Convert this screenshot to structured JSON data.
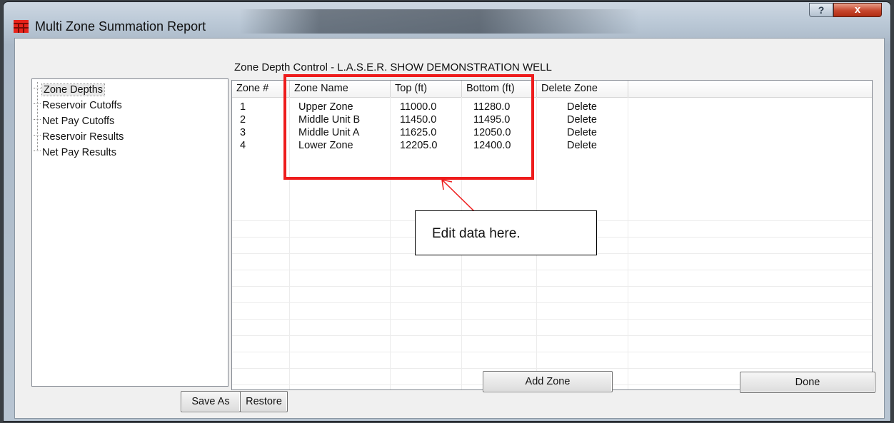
{
  "window": {
    "title": "Multi Zone Summation Report",
    "help_label": "?",
    "close_label": "x"
  },
  "section_title": "Zone Depth Control - L.A.S.E.R. SHOW DEMONSTRATION WELL",
  "tree": {
    "items": [
      {
        "label": "Zone Depths",
        "selected": true
      },
      {
        "label": "Reservoir Cutoffs",
        "selected": false
      },
      {
        "label": "Net Pay Cutoffs",
        "selected": false
      },
      {
        "label": "Reservoir Results",
        "selected": false
      },
      {
        "label": "Net Pay Results",
        "selected": false
      }
    ]
  },
  "grid": {
    "columns": [
      "Zone #",
      "Zone Name",
      "Top (ft)",
      "Bottom (ft)",
      "Delete Zone"
    ],
    "rows": [
      {
        "num": "1",
        "name": "Upper Zone",
        "top": "11000.0",
        "bottom": "11280.0",
        "delete": "Delete"
      },
      {
        "num": "2",
        "name": "Middle Unit B",
        "top": "11450.0",
        "bottom": "11495.0",
        "delete": "Delete"
      },
      {
        "num": "3",
        "name": "Middle Unit A",
        "top": "11625.0",
        "bottom": "12050.0",
        "delete": "Delete"
      },
      {
        "num": "4",
        "name": "Lower Zone",
        "top": "12205.0",
        "bottom": "12400.0",
        "delete": "Delete"
      }
    ]
  },
  "buttons": {
    "add_zone": "Add Zone",
    "done": "Done",
    "save_as": "Save As",
    "restore": "Restore"
  },
  "annotation": {
    "callout_text": "Edit data here.",
    "color": "#ee1c1c"
  }
}
